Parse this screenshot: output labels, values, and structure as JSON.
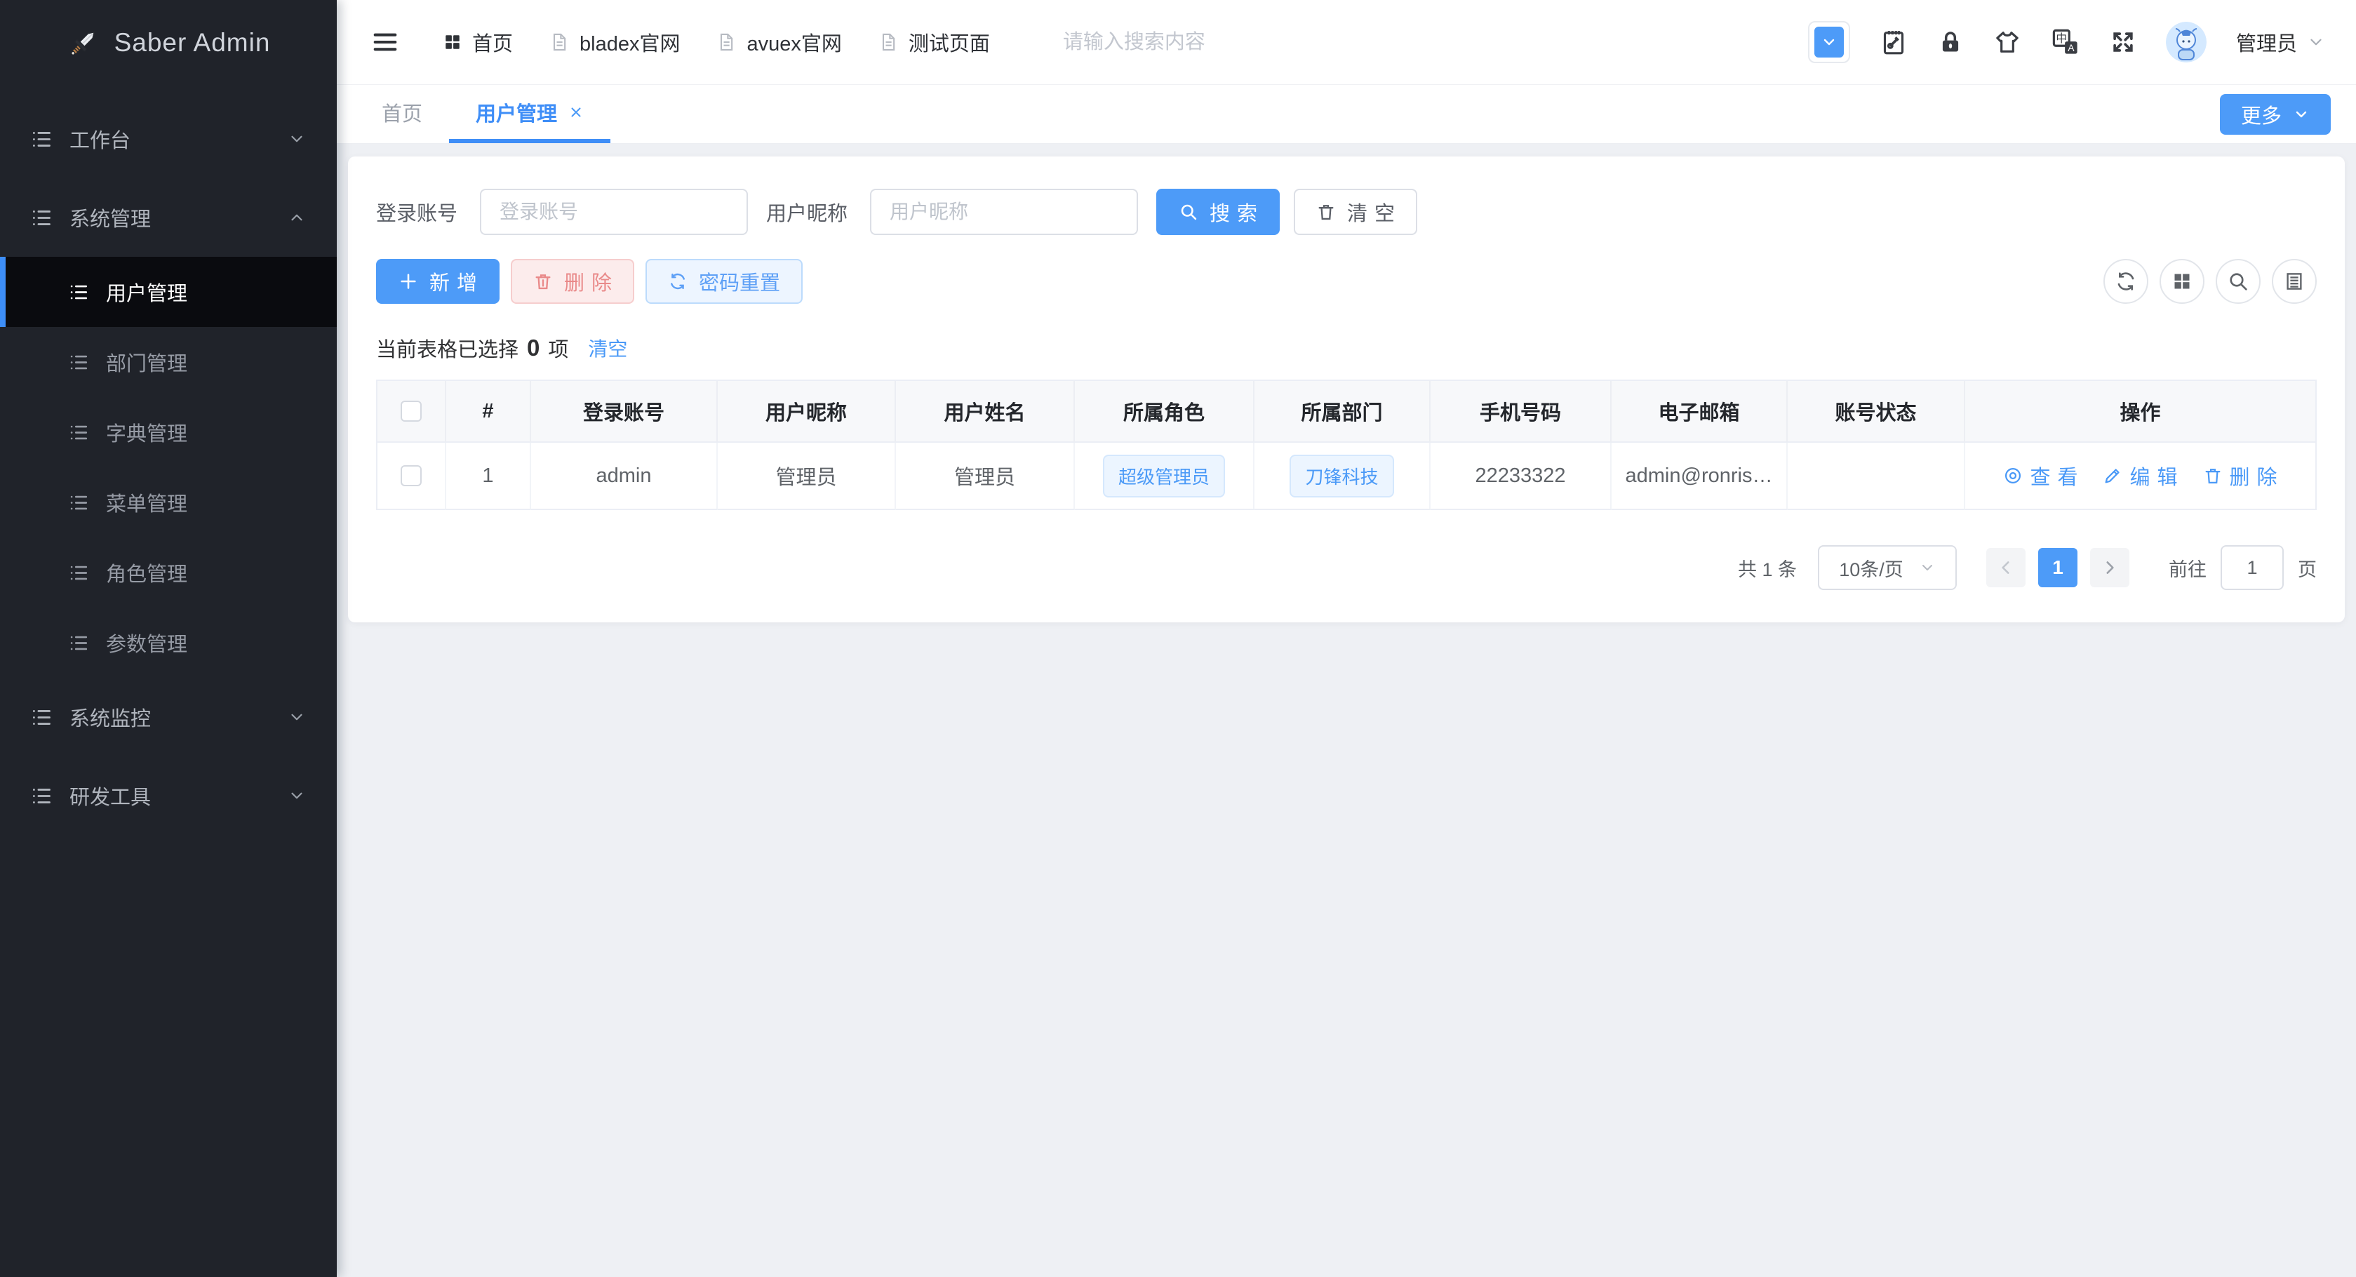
{
  "sidebar": {
    "logo": "Saber Admin",
    "items": [
      {
        "label": "工作台"
      },
      {
        "label": "系统管理"
      },
      {
        "label": "用户管理"
      },
      {
        "label": "部门管理"
      },
      {
        "label": "字典管理"
      },
      {
        "label": "菜单管理"
      },
      {
        "label": "角色管理"
      },
      {
        "label": "参数管理"
      },
      {
        "label": "系统监控"
      },
      {
        "label": "研发工具"
      }
    ]
  },
  "topbar": {
    "nav": [
      {
        "label": "首页"
      },
      {
        "label": "bladex官网"
      },
      {
        "label": "avuex官网"
      },
      {
        "label": "测试页面"
      }
    ],
    "search_placeholder": "请输入搜索内容",
    "username": "管理员"
  },
  "tabs": {
    "items": [
      {
        "label": "首页"
      },
      {
        "label": "用户管理"
      }
    ],
    "more_label": "更多"
  },
  "filters": {
    "account": {
      "label": "登录账号",
      "placeholder": "登录账号"
    },
    "nickname": {
      "label": "用户昵称",
      "placeholder": "用户昵称"
    },
    "search_label": "搜索",
    "clear_label": "清空"
  },
  "toolbar": {
    "add_label": "新增",
    "delete_label": "删除",
    "reset_label": "密码重置"
  },
  "selection": {
    "prefix": "当前表格已选择",
    "count": "0",
    "suffix": "项",
    "clear_label": "清空"
  },
  "table": {
    "columns": [
      "#",
      "登录账号",
      "用户昵称",
      "用户姓名",
      "所属角色",
      "所属部门",
      "手机号码",
      "电子邮箱",
      "账号状态",
      "操作"
    ],
    "rows": [
      {
        "index": "1",
        "account": "admin",
        "nickname": "管理员",
        "name": "管理员",
        "role": "超级管理员",
        "dept": "刀锋科技",
        "phone": "22233322",
        "email": "admin@ronris…",
        "status": "",
        "actions": {
          "view": "查看",
          "edit": "编辑",
          "del": "删除"
        }
      }
    ]
  },
  "pagination": {
    "total": "共 1 条",
    "page_size": "10条/页",
    "current_page": "1",
    "goto_label": "前往",
    "goto_value": "1",
    "unit_label": "页"
  },
  "colors": {
    "primary": "#409eff",
    "button_blue": "#4d9bf8",
    "sidebar_bg": "#20232a",
    "danger_text": "#e98989",
    "page_bg": "#eef0f4"
  }
}
